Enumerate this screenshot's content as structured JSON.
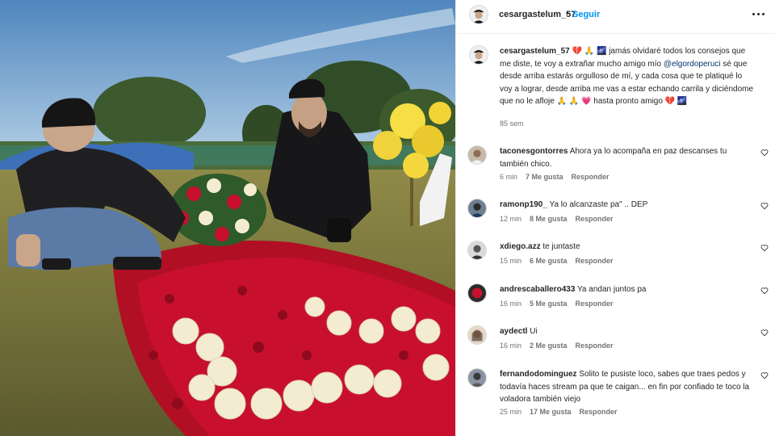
{
  "post": {
    "username": "cesargastelum_57",
    "follow_label": "Seguir",
    "separator": "•",
    "more_icon": "more-options-icon"
  },
  "caption": {
    "username": "cesargastelum_57",
    "emojis_lead": " 💔 🙏 🌌 ",
    "part1": "jamás olvidaré todos los consejos que me diste, te voy a extrañar mucho amigo mío ",
    "mention": "@elgordoperuci",
    "part2": " sé que desde arriba estarás orgulloso de mí, y cada cosa que te platiqué lo voy a lograr, desde arriba me vas a estar echando carrila y diciéndome que no le afloje 🙏 🙏 💗 hasta pronto amigo 💔 🌌",
    "time": "85 sem"
  },
  "comments": [
    {
      "username": "taconesgontorres",
      "text": "Ahora ya lo acompaña en paz descanses tu también chico.",
      "time": "6 min",
      "likes": "7 Me gusta",
      "reply": "Responder"
    },
    {
      "username": "ramonp190_",
      "text": "Ya lo alcanzaste pa\" .. DEP",
      "time": "12 min",
      "likes": "8 Me gusta",
      "reply": "Responder"
    },
    {
      "username": "xdiego.azz",
      "text": "te juntaste",
      "time": "15 min",
      "likes": "6 Me gusta",
      "reply": "Responder"
    },
    {
      "username": "andrescaballero433",
      "text": "Ya andan juntos pa",
      "time": "16 min",
      "likes": "5 Me gusta",
      "reply": "Responder"
    },
    {
      "username": "aydectl",
      "text": "Ui",
      "time": "16 min",
      "likes": "2 Me gusta",
      "reply": "Responder"
    },
    {
      "username": "fernandodominguez",
      "text": "Solito te pusiste loco, sabes que traes pedos y todavía haces stream pa que te caigan... en fin por confiado te toco la voladora también viejo",
      "time": "25 min",
      "likes": "17 Me gusta",
      "reply": "Responder"
    }
  ],
  "colors": {
    "link_blue": "#0095f6",
    "mention_blue": "#00376b",
    "meta_gray": "#737373",
    "rose_red": "#c8102e",
    "rose_white": "#f3ecd2"
  }
}
